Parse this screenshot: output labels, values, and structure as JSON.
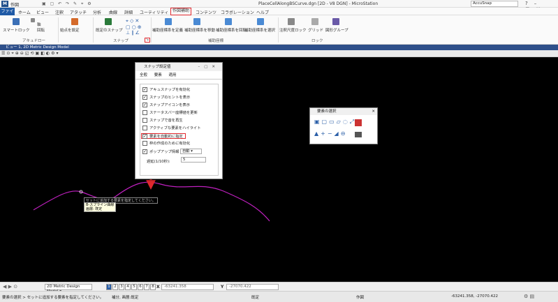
{
  "titlebar": {
    "workspace": "作図",
    "title": "PlaceCellAlongBSCurve.dgn [2D - V8 DGN] - MicroStation",
    "search": "AccuSnap"
  },
  "menu": [
    "ファイル",
    "ホーム",
    "ビュー",
    "注釈",
    "アタッチ",
    "分析",
    "曲線",
    "詳細",
    "ユーティリティ",
    "作図補助",
    "コンテンツ",
    "コラボレーション",
    "ヘルプ"
  ],
  "ribbon": {
    "smartlock": "スマートロック",
    "axis": "軸",
    "rotate": "回転",
    "origin_set": "始点を設定",
    "default_snap": "既定のスナップ",
    "acs_define": "補助座標系を定義",
    "acs_move": "補助座標系を移動",
    "acs_rotate": "補助座標系を回転",
    "acs_select": "補助座標系を選択",
    "note_lock": "注釈尺度ロック",
    "grid": "グリッド",
    "graphic_group": "図形グループ",
    "group_accudraw": "アキュドロー",
    "group_snap": "スナップ",
    "group_acs": "補助座標",
    "group_lock": "ロック"
  },
  "view": {
    "title": "ビュー 1, 2D Metric Design Model"
  },
  "snap_dialog": {
    "title": "スナップ設定値",
    "tabs": [
      "全般",
      "要素",
      "適用"
    ],
    "options": [
      {
        "label": "アキュスナップを有効化",
        "checked": true
      },
      {
        "label": "スナップのヒントを表示",
        "checked": true
      },
      {
        "label": "スナップアイコンを表示",
        "checked": true
      },
      {
        "label": "ステータスバー座標値を更新",
        "checked": false
      },
      {
        "label": "スナップで音を再生",
        "checked": false
      },
      {
        "label": "アクティブな要素をハイライト",
        "checked": false
      },
      {
        "label": "要素を自動的に指定",
        "checked": true
      },
      {
        "label": "枠の作成のために有効化",
        "checked": false
      }
    ],
    "popup_label": "ポップアップ情報",
    "popup_checked": true,
    "popup_value": "自動",
    "delay_label": "遅延(1/10秒):",
    "delay_value": "5"
  },
  "select_palette": {
    "title": "要素の選択"
  },
  "canvas": {
    "tooltip": "セットに追加する要素を指定してください。",
    "tip_line1": "B-スプライン曲線",
    "tip_line2": "画層: 既定"
  },
  "viewbar": {
    "model": "2D Metric Design Model",
    "views": [
      "1",
      "2",
      "3",
      "4",
      "5",
      "6",
      "7",
      "8"
    ],
    "x_label": "X",
    "x_value": "-63241.358",
    "y_label": "Y",
    "y_value": "-27070.422"
  },
  "status": {
    "prompt": "要素の選択 > セットに追加する要素を指定してください。",
    "snap": "補分, 画層:既定",
    "lock": "既定",
    "workspace": "作図",
    "coords": "-63241.358, -27070.422"
  },
  "colors": {
    "accent": "#1f5aa6",
    "highlight": "#e0282e",
    "curve": "#c020c0"
  }
}
